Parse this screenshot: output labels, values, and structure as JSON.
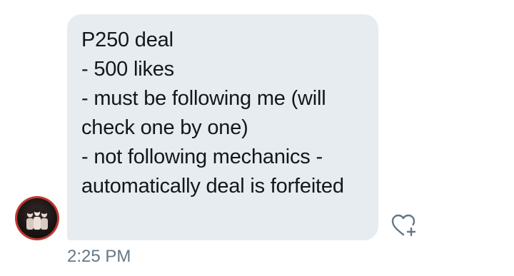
{
  "message": {
    "lines": [
      "P250 deal",
      "",
      "- 500 likes",
      "- must be following me (will",
      "check one by one)",
      "- not following mechanics -",
      "automatically deal is forfeited"
    ]
  },
  "timestamp": "2:25 PM",
  "icons": {
    "avatar": "profile-avatar",
    "like": "heart-plus-icon"
  },
  "colors": {
    "bubble": "#e6ecf0",
    "text": "#14171a",
    "meta": "#657786",
    "avatar_ring": "#c0392b"
  }
}
